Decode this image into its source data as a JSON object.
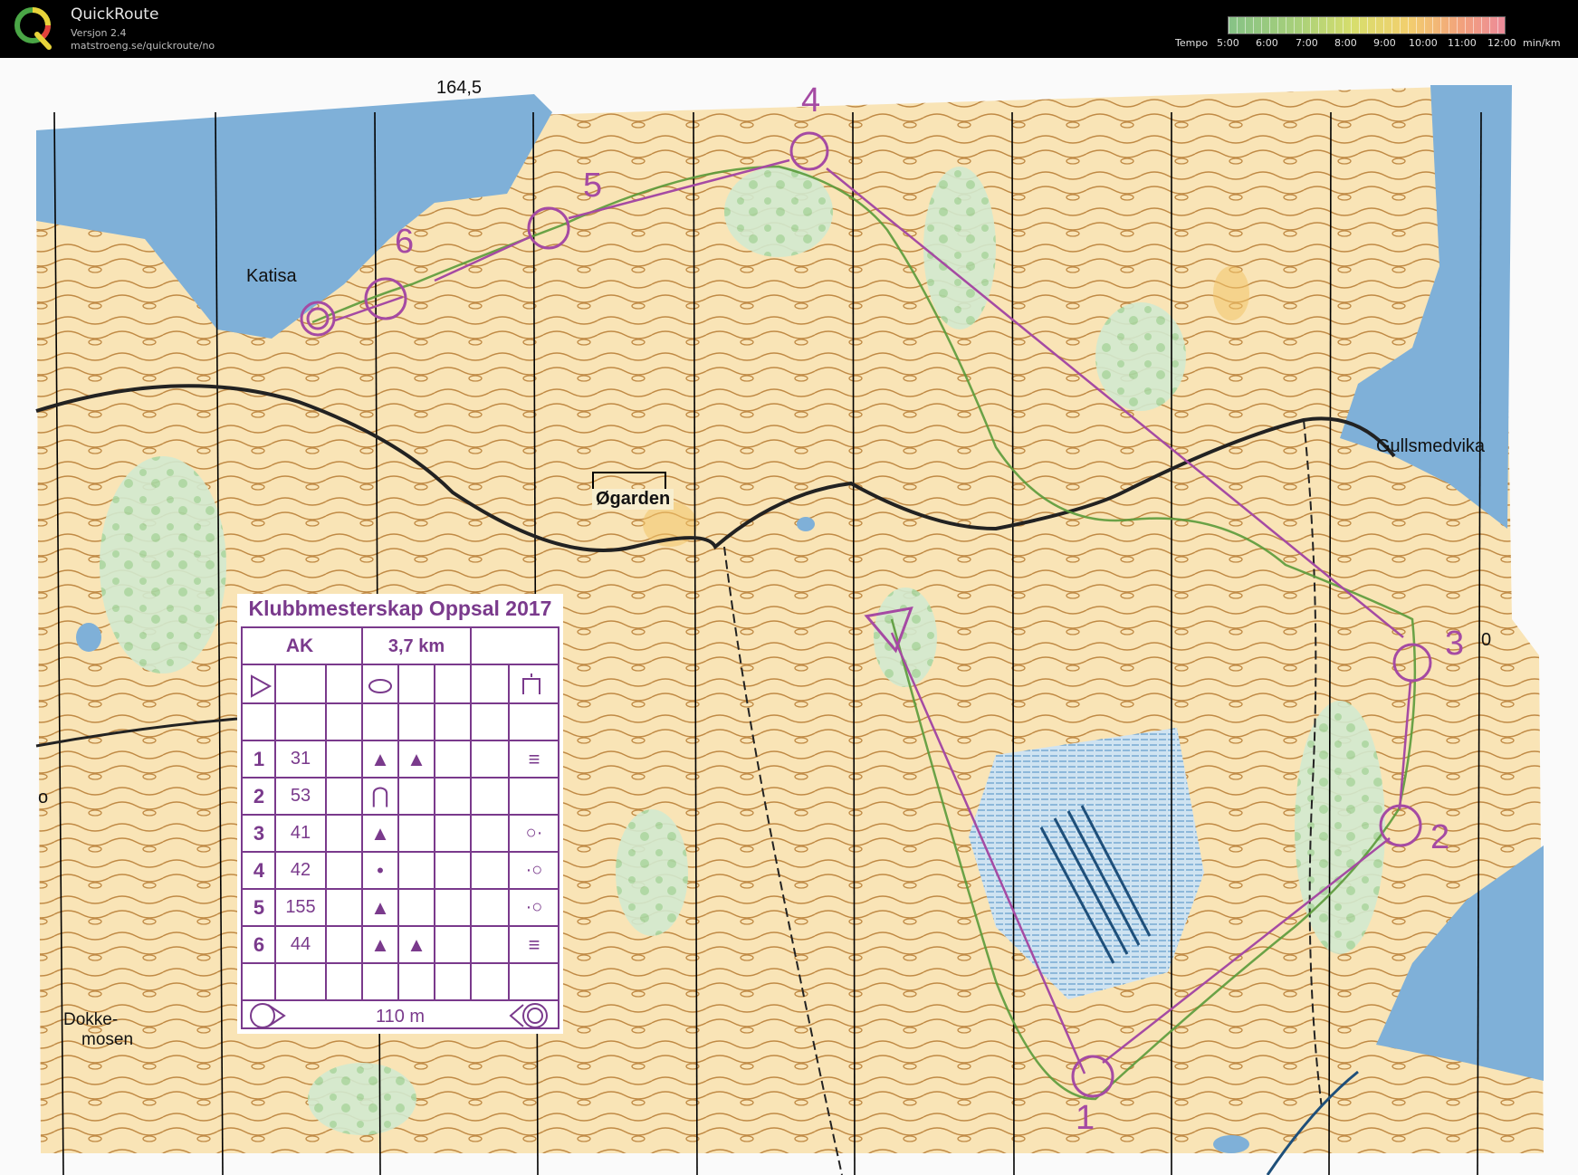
{
  "app": {
    "title": "QuickRoute",
    "version": "Versjon 2.4",
    "url": "matstroeng.se/quickroute/no",
    "logo_letter": "Q"
  },
  "pace_legend": {
    "label": "Tempo",
    "ticks": [
      "5:00",
      "6:00",
      "7:00",
      "8:00",
      "9:00",
      "10:00",
      "11:00",
      "12:00"
    ],
    "unit": "min/km"
  },
  "map": {
    "place_names": {
      "katisa": "Katisa",
      "ogarden": "Øgarden",
      "gullsmedvika": "Gullsmedvika",
      "dokkemosen_1": "Dokke-",
      "dokkemosen_2": "mosen",
      "height": "164,5",
      "edge_zero": "0",
      "edge_o": "o"
    },
    "controls": [
      "1",
      "2",
      "3",
      "4",
      "5",
      "6"
    ],
    "colors": {
      "course": "#a54aa3",
      "route": "#5a9a3a",
      "water": "#7fb0d8",
      "contour": "#b5823c",
      "vegetation": "#b9dcb0",
      "open_land": "#f6deab"
    }
  },
  "course_card": {
    "title": "Klubbmesterskap Oppsal 2017",
    "class": "AK",
    "length": "3,7 km",
    "rows": [
      {
        "num": "1",
        "code": "31",
        "features": [
          "▲",
          "▲"
        ],
        "detail": "≡"
      },
      {
        "num": "2",
        "code": "53",
        "features": [
          "⋂"
        ],
        "detail": ""
      },
      {
        "num": "3",
        "code": "41",
        "features": [
          "▲"
        ],
        "detail": "○·"
      },
      {
        "num": "4",
        "code": "42",
        "features": [
          "•"
        ],
        "detail": "·○"
      },
      {
        "num": "5",
        "code": "155",
        "features": [
          "▲"
        ],
        "detail": "·○"
      },
      {
        "num": "6",
        "code": "44",
        "features": [
          "▲",
          "▲"
        ],
        "detail": "≡"
      }
    ],
    "finish_distance": "110 m"
  }
}
